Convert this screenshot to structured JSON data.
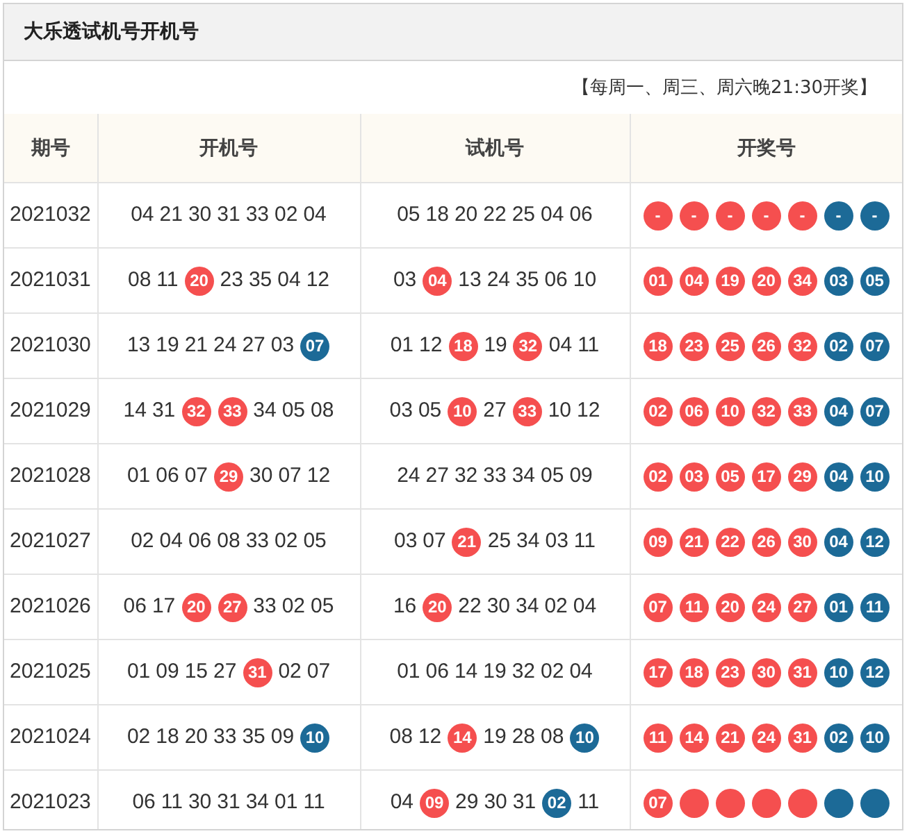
{
  "title": "大乐透试机号开机号",
  "schedule": "【每周一、周三、周六晚21:30开奖】",
  "columns": [
    "期号",
    "开机号",
    "试机号",
    "开奖号"
  ],
  "rows": [
    {
      "period": "2021032",
      "open": [
        {
          "n": "04",
          "kind": "plain"
        },
        {
          "n": "21",
          "kind": "plain"
        },
        {
          "n": "30",
          "kind": "plain"
        },
        {
          "n": "31",
          "kind": "plain"
        },
        {
          "n": "33",
          "kind": "plain"
        },
        {
          "n": "02",
          "kind": "plain"
        },
        {
          "n": "04",
          "kind": "plain"
        }
      ],
      "test": [
        {
          "n": "05",
          "kind": "plain"
        },
        {
          "n": "18",
          "kind": "plain"
        },
        {
          "n": "20",
          "kind": "plain"
        },
        {
          "n": "22",
          "kind": "plain"
        },
        {
          "n": "25",
          "kind": "plain"
        },
        {
          "n": "04",
          "kind": "plain"
        },
        {
          "n": "06",
          "kind": "plain"
        }
      ],
      "draw": [
        {
          "n": "-",
          "kind": "red"
        },
        {
          "n": "-",
          "kind": "red"
        },
        {
          "n": "-",
          "kind": "red"
        },
        {
          "n": "-",
          "kind": "red"
        },
        {
          "n": "-",
          "kind": "red"
        },
        {
          "n": "-",
          "kind": "blue"
        },
        {
          "n": "-",
          "kind": "blue"
        }
      ]
    },
    {
      "period": "2021031",
      "open": [
        {
          "n": "08",
          "kind": "plain"
        },
        {
          "n": "11",
          "kind": "plain"
        },
        {
          "n": "20",
          "kind": "red"
        },
        {
          "n": "23",
          "kind": "plain"
        },
        {
          "n": "35",
          "kind": "plain"
        },
        {
          "n": "04",
          "kind": "plain"
        },
        {
          "n": "12",
          "kind": "plain"
        }
      ],
      "test": [
        {
          "n": "03",
          "kind": "plain"
        },
        {
          "n": "04",
          "kind": "red"
        },
        {
          "n": "13",
          "kind": "plain"
        },
        {
          "n": "24",
          "kind": "plain"
        },
        {
          "n": "35",
          "kind": "plain"
        },
        {
          "n": "06",
          "kind": "plain"
        },
        {
          "n": "10",
          "kind": "plain"
        }
      ],
      "draw": [
        {
          "n": "01",
          "kind": "red"
        },
        {
          "n": "04",
          "kind": "red"
        },
        {
          "n": "19",
          "kind": "red"
        },
        {
          "n": "20",
          "kind": "red"
        },
        {
          "n": "34",
          "kind": "red"
        },
        {
          "n": "03",
          "kind": "blue"
        },
        {
          "n": "05",
          "kind": "blue"
        }
      ]
    },
    {
      "period": "2021030",
      "open": [
        {
          "n": "13",
          "kind": "plain"
        },
        {
          "n": "19",
          "kind": "plain"
        },
        {
          "n": "21",
          "kind": "plain"
        },
        {
          "n": "24",
          "kind": "plain"
        },
        {
          "n": "27",
          "kind": "plain"
        },
        {
          "n": "03",
          "kind": "plain"
        },
        {
          "n": "07",
          "kind": "blue"
        }
      ],
      "test": [
        {
          "n": "01",
          "kind": "plain"
        },
        {
          "n": "12",
          "kind": "plain"
        },
        {
          "n": "18",
          "kind": "red"
        },
        {
          "n": "19",
          "kind": "plain"
        },
        {
          "n": "32",
          "kind": "red"
        },
        {
          "n": "04",
          "kind": "plain"
        },
        {
          "n": "11",
          "kind": "plain"
        }
      ],
      "draw": [
        {
          "n": "18",
          "kind": "red"
        },
        {
          "n": "23",
          "kind": "red"
        },
        {
          "n": "25",
          "kind": "red"
        },
        {
          "n": "26",
          "kind": "red"
        },
        {
          "n": "32",
          "kind": "red"
        },
        {
          "n": "02",
          "kind": "blue"
        },
        {
          "n": "07",
          "kind": "blue"
        }
      ]
    },
    {
      "period": "2021029",
      "open": [
        {
          "n": "14",
          "kind": "plain"
        },
        {
          "n": "31",
          "kind": "plain"
        },
        {
          "n": "32",
          "kind": "red"
        },
        {
          "n": "33",
          "kind": "red"
        },
        {
          "n": "34",
          "kind": "plain"
        },
        {
          "n": "05",
          "kind": "plain"
        },
        {
          "n": "08",
          "kind": "plain"
        }
      ],
      "test": [
        {
          "n": "03",
          "kind": "plain"
        },
        {
          "n": "05",
          "kind": "plain"
        },
        {
          "n": "10",
          "kind": "red"
        },
        {
          "n": "27",
          "kind": "plain"
        },
        {
          "n": "33",
          "kind": "red"
        },
        {
          "n": "10",
          "kind": "plain"
        },
        {
          "n": "12",
          "kind": "plain"
        }
      ],
      "draw": [
        {
          "n": "02",
          "kind": "red"
        },
        {
          "n": "06",
          "kind": "red"
        },
        {
          "n": "10",
          "kind": "red"
        },
        {
          "n": "32",
          "kind": "red"
        },
        {
          "n": "33",
          "kind": "red"
        },
        {
          "n": "04",
          "kind": "blue"
        },
        {
          "n": "07",
          "kind": "blue"
        }
      ]
    },
    {
      "period": "2021028",
      "open": [
        {
          "n": "01",
          "kind": "plain"
        },
        {
          "n": "06",
          "kind": "plain"
        },
        {
          "n": "07",
          "kind": "plain"
        },
        {
          "n": "29",
          "kind": "red"
        },
        {
          "n": "30",
          "kind": "plain"
        },
        {
          "n": "07",
          "kind": "plain"
        },
        {
          "n": "12",
          "kind": "plain"
        }
      ],
      "test": [
        {
          "n": "24",
          "kind": "plain"
        },
        {
          "n": "27",
          "kind": "plain"
        },
        {
          "n": "32",
          "kind": "plain"
        },
        {
          "n": "33",
          "kind": "plain"
        },
        {
          "n": "34",
          "kind": "plain"
        },
        {
          "n": "05",
          "kind": "plain"
        },
        {
          "n": "09",
          "kind": "plain"
        }
      ],
      "draw": [
        {
          "n": "02",
          "kind": "red"
        },
        {
          "n": "03",
          "kind": "red"
        },
        {
          "n": "05",
          "kind": "red"
        },
        {
          "n": "17",
          "kind": "red"
        },
        {
          "n": "29",
          "kind": "red"
        },
        {
          "n": "04",
          "kind": "blue"
        },
        {
          "n": "10",
          "kind": "blue"
        }
      ]
    },
    {
      "period": "2021027",
      "open": [
        {
          "n": "02",
          "kind": "plain"
        },
        {
          "n": "04",
          "kind": "plain"
        },
        {
          "n": "06",
          "kind": "plain"
        },
        {
          "n": "08",
          "kind": "plain"
        },
        {
          "n": "33",
          "kind": "plain"
        },
        {
          "n": "02",
          "kind": "plain"
        },
        {
          "n": "05",
          "kind": "plain"
        }
      ],
      "test": [
        {
          "n": "03",
          "kind": "plain"
        },
        {
          "n": "07",
          "kind": "plain"
        },
        {
          "n": "21",
          "kind": "red"
        },
        {
          "n": "25",
          "kind": "plain"
        },
        {
          "n": "34",
          "kind": "plain"
        },
        {
          "n": "03",
          "kind": "plain"
        },
        {
          "n": "11",
          "kind": "plain"
        }
      ],
      "draw": [
        {
          "n": "09",
          "kind": "red"
        },
        {
          "n": "21",
          "kind": "red"
        },
        {
          "n": "22",
          "kind": "red"
        },
        {
          "n": "26",
          "kind": "red"
        },
        {
          "n": "30",
          "kind": "red"
        },
        {
          "n": "04",
          "kind": "blue"
        },
        {
          "n": "12",
          "kind": "blue"
        }
      ]
    },
    {
      "period": "2021026",
      "open": [
        {
          "n": "06",
          "kind": "plain"
        },
        {
          "n": "17",
          "kind": "plain"
        },
        {
          "n": "20",
          "kind": "red"
        },
        {
          "n": "27",
          "kind": "red"
        },
        {
          "n": "33",
          "kind": "plain"
        },
        {
          "n": "02",
          "kind": "plain"
        },
        {
          "n": "05",
          "kind": "plain"
        }
      ],
      "test": [
        {
          "n": "16",
          "kind": "plain"
        },
        {
          "n": "20",
          "kind": "red"
        },
        {
          "n": "22",
          "kind": "plain"
        },
        {
          "n": "30",
          "kind": "plain"
        },
        {
          "n": "34",
          "kind": "plain"
        },
        {
          "n": "02",
          "kind": "plain"
        },
        {
          "n": "04",
          "kind": "plain"
        }
      ],
      "draw": [
        {
          "n": "07",
          "kind": "red"
        },
        {
          "n": "11",
          "kind": "red"
        },
        {
          "n": "20",
          "kind": "red"
        },
        {
          "n": "24",
          "kind": "red"
        },
        {
          "n": "27",
          "kind": "red"
        },
        {
          "n": "01",
          "kind": "blue"
        },
        {
          "n": "11",
          "kind": "blue"
        }
      ]
    },
    {
      "period": "2021025",
      "open": [
        {
          "n": "01",
          "kind": "plain"
        },
        {
          "n": "09",
          "kind": "plain"
        },
        {
          "n": "15",
          "kind": "plain"
        },
        {
          "n": "27",
          "kind": "plain"
        },
        {
          "n": "31",
          "kind": "red"
        },
        {
          "n": "02",
          "kind": "plain"
        },
        {
          "n": "07",
          "kind": "plain"
        }
      ],
      "test": [
        {
          "n": "01",
          "kind": "plain"
        },
        {
          "n": "06",
          "kind": "plain"
        },
        {
          "n": "14",
          "kind": "plain"
        },
        {
          "n": "19",
          "kind": "plain"
        },
        {
          "n": "32",
          "kind": "plain"
        },
        {
          "n": "02",
          "kind": "plain"
        },
        {
          "n": "04",
          "kind": "plain"
        }
      ],
      "draw": [
        {
          "n": "17",
          "kind": "red"
        },
        {
          "n": "18",
          "kind": "red"
        },
        {
          "n": "23",
          "kind": "red"
        },
        {
          "n": "30",
          "kind": "red"
        },
        {
          "n": "31",
          "kind": "red"
        },
        {
          "n": "10",
          "kind": "blue"
        },
        {
          "n": "12",
          "kind": "blue"
        }
      ]
    },
    {
      "period": "2021024",
      "open": [
        {
          "n": "02",
          "kind": "plain"
        },
        {
          "n": "18",
          "kind": "plain"
        },
        {
          "n": "20",
          "kind": "plain"
        },
        {
          "n": "33",
          "kind": "plain"
        },
        {
          "n": "35",
          "kind": "plain"
        },
        {
          "n": "09",
          "kind": "plain"
        },
        {
          "n": "10",
          "kind": "blue"
        }
      ],
      "test": [
        {
          "n": "08",
          "kind": "plain"
        },
        {
          "n": "12",
          "kind": "plain"
        },
        {
          "n": "14",
          "kind": "red"
        },
        {
          "n": "19",
          "kind": "plain"
        },
        {
          "n": "28",
          "kind": "plain"
        },
        {
          "n": "08",
          "kind": "plain"
        },
        {
          "n": "10",
          "kind": "blue"
        }
      ],
      "draw": [
        {
          "n": "11",
          "kind": "red"
        },
        {
          "n": "14",
          "kind": "red"
        },
        {
          "n": "21",
          "kind": "red"
        },
        {
          "n": "24",
          "kind": "red"
        },
        {
          "n": "31",
          "kind": "red"
        },
        {
          "n": "02",
          "kind": "blue"
        },
        {
          "n": "10",
          "kind": "blue"
        }
      ]
    },
    {
      "period": "2021023",
      "open": [
        {
          "n": "06",
          "kind": "plain"
        },
        {
          "n": "11",
          "kind": "plain"
        },
        {
          "n": "30",
          "kind": "plain"
        },
        {
          "n": "31",
          "kind": "plain"
        },
        {
          "n": "34",
          "kind": "plain"
        },
        {
          "n": "01",
          "kind": "plain"
        },
        {
          "n": "11",
          "kind": "plain"
        }
      ],
      "test": [
        {
          "n": "04",
          "kind": "plain"
        },
        {
          "n": "09",
          "kind": "red"
        },
        {
          "n": "29",
          "kind": "plain"
        },
        {
          "n": "30",
          "kind": "plain"
        },
        {
          "n": "31",
          "kind": "plain"
        },
        {
          "n": "02",
          "kind": "blue"
        },
        {
          "n": "11",
          "kind": "plain"
        }
      ],
      "draw": [
        {
          "n": "07",
          "kind": "red"
        },
        {
          "kind": "red"
        },
        {
          "kind": "red"
        },
        {
          "kind": "red"
        },
        {
          "kind": "red"
        },
        {
          "kind": "blue"
        },
        {
          "kind": "blue"
        }
      ]
    }
  ]
}
